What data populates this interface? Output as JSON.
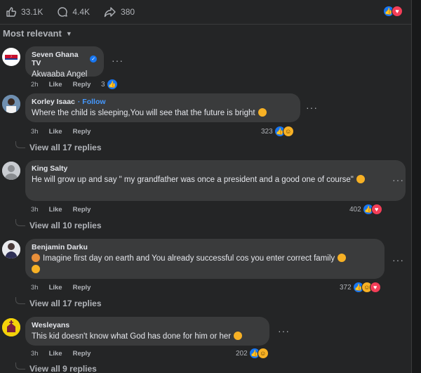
{
  "stats": {
    "likes": "33.1K",
    "comments": "4.4K",
    "shares": "380"
  },
  "sort_label": "Most relevant",
  "more_symbol": "···",
  "comments": [
    {
      "author": "Seven Ghana TV",
      "verified": true,
      "follow": "",
      "text": "Akwaaba Angel",
      "time": "2h",
      "like": "Like",
      "reply": "Reply",
      "reactions_count": "3",
      "replies": ""
    },
    {
      "author": "Korley Isaac",
      "verified": false,
      "follow": "· Follow",
      "text": "Where the child is sleeping,You will see that the future is bright",
      "time": "3h",
      "like": "Like",
      "reply": "Reply",
      "reactions_count": "323",
      "replies": "View all 17 replies"
    },
    {
      "author": "King Salty",
      "verified": false,
      "follow": "",
      "text": "He will grow up and say \" my grandfather was once a president and a good one of course\"",
      "time": "3h",
      "like": "Like",
      "reply": "Reply",
      "reactions_count": "402",
      "replies": "View all 10 replies"
    },
    {
      "author": "Benjamin Darku",
      "verified": false,
      "follow": "",
      "text": "Imagine first day on earth and You already successful cos you enter correct family",
      "time": "3h",
      "like": "Like",
      "reply": "Reply",
      "reactions_count": "372",
      "replies": "View all 17 replies"
    },
    {
      "author": "Wesleyans",
      "verified": false,
      "follow": "",
      "text": "This kid doesn't know what God has done for him or her",
      "time": "3h",
      "like": "Like",
      "reply": "Reply",
      "reactions_count": "202",
      "replies": "View all 9 replies"
    }
  ]
}
